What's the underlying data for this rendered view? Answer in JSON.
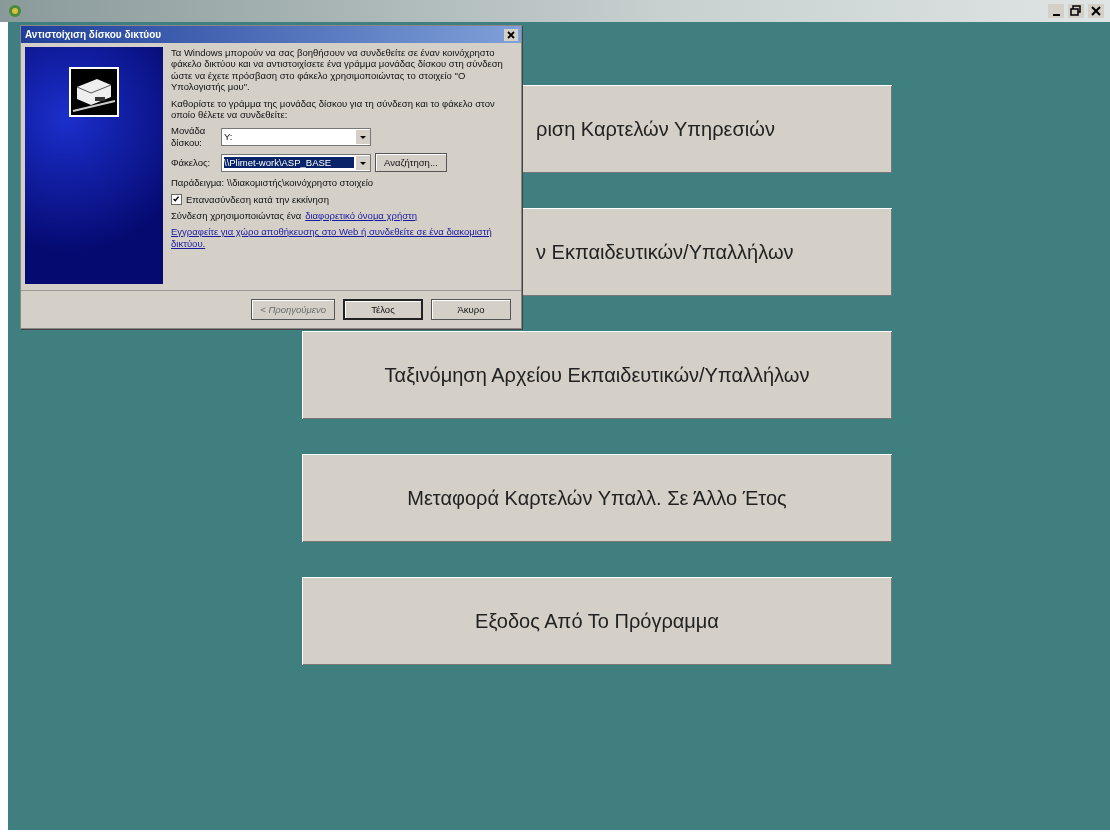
{
  "dialog": {
    "title": "Αντιστοίχιση δίσκου δικτύου",
    "intro": "Τα Windows μπορούν να σας βοηθήσουν να συνδεθείτε σε έναν κοινόχρηστο φάκελο δικτύου και να αντιστοιχίσετε ένα γράμμα μονάδας δίσκου στη σύνδεση ώστε να έχετε πρόσβαση στο φάκελο χρησιμοποιώντας το στοιχείο \"Ο Υπολογιστής μου\".",
    "instruction": "Καθορίστε το γράμμα της μονάδας δίσκου για τη σύνδεση και το φάκελο στον οποίο θέλετε να συνδεθείτε:",
    "drive": {
      "label": "Μονάδα δίσκου:",
      "value": "Y:"
    },
    "folder": {
      "label": "Φάκελος:",
      "value": "\\\\Plimet-work\\ASP_BASE",
      "selected": true
    },
    "browse_button": "Αναζήτηση...",
    "example": "Παράδειγμα: \\\\διακομιστής\\κοινόχρηστο στοιχείο",
    "reconnect": {
      "label": "Επανασύνδεση κατά την εκκίνηση",
      "checked": true
    },
    "connect_text": "Σύνδεση χρησιμοποιώντας ένα",
    "connect_link": "διαφορετικό όνομα χρήστη",
    "signup_link": "Εγγραφείτε για χώρο αποθήκευσης στο Web ή συνδεθείτε σε ένα διακομιστή δικτύου.",
    "buttons": [
      {
        "label": "< Προηγούμενο",
        "disabled": true,
        "default": false
      },
      {
        "label": "Τέλος",
        "disabled": false,
        "default": true
      },
      {
        "label": "Άκυρο",
        "disabled": false,
        "default": false
      }
    ]
  },
  "menu_buttons": [
    {
      "label": "ριση Καρτελών Υπηρεσιών",
      "kind": "covered"
    },
    {
      "label": "ν Εκπαιδευτικών/Υπαλλήλων",
      "kind": "covered"
    },
    {
      "label": "Ταξινόμηση Αρχείου Εκπαιδευτικών/Υπαλλήλων",
      "kind": "full"
    },
    {
      "label": "Μεταφορά Καρτελών Υπαλλ. Σε  Άλλο Έτος",
      "kind": "full"
    },
    {
      "label": "Εξοδος Από Το Πρόγραμμα",
      "kind": "full"
    }
  ]
}
